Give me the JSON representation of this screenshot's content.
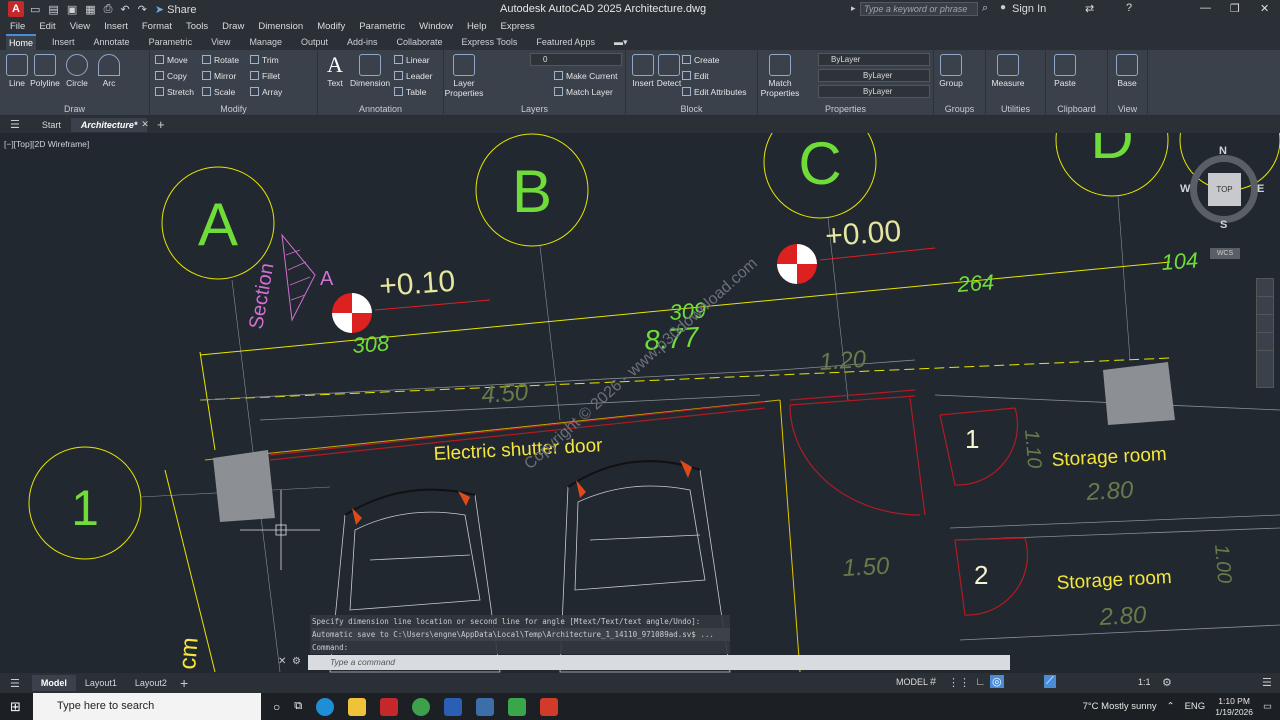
{
  "title_bar": {
    "app_icon": "A",
    "share_label": "Share",
    "title": "Autodesk AutoCAD 2025   Architecture.dwg",
    "search_placeholder": "Type a keyword or phrase",
    "sign_in": "Sign In"
  },
  "menu": [
    "File",
    "Edit",
    "View",
    "Insert",
    "Format",
    "Tools",
    "Draw",
    "Dimension",
    "Modify",
    "Parametric",
    "Window",
    "Help",
    "Express"
  ],
  "ribbon_tabs": [
    "Home",
    "Insert",
    "Annotate",
    "Parametric",
    "View",
    "Manage",
    "Output",
    "Add-ins",
    "Collaborate",
    "Express Tools",
    "Featured Apps"
  ],
  "ribbon": {
    "draw": {
      "title": "Draw",
      "tools": [
        "Line",
        "Polyline",
        "Circle",
        "Arc"
      ]
    },
    "modify": {
      "title": "Modify",
      "tools": [
        "Move",
        "Rotate",
        "Trim",
        "Copy",
        "Mirror",
        "Fillet",
        "Stretch",
        "Scale",
        "Array"
      ]
    },
    "annotation": {
      "title": "Annotation",
      "tools": [
        "Text",
        "Dimension",
        "Linear",
        "Leader",
        "Table"
      ]
    },
    "layers": {
      "title": "Layers",
      "layer_properties": "Layer Properties",
      "current_layer": "0",
      "make_current": "Make Current",
      "match_layer": "Match Layer"
    },
    "block": {
      "title": "Block",
      "tools": [
        "Insert",
        "Detect",
        "Create",
        "Edit",
        "Edit Attributes"
      ]
    },
    "properties": {
      "title": "Properties",
      "match": "Match Properties",
      "color": "ByLayer",
      "linetype": "ByLayer",
      "lineweight": "ByLayer"
    },
    "groups": {
      "title": "Groups",
      "group": "Group"
    },
    "utilities": {
      "title": "Utilities",
      "measure": "Measure"
    },
    "clipboard": {
      "title": "Clipboard",
      "paste": "Paste"
    },
    "view": {
      "title": "View",
      "base": "Base"
    }
  },
  "doc_tabs": [
    "Start",
    "Architecture*"
  ],
  "viewport": {
    "label": "[−][Top][2D Wireframe]",
    "viewcube": {
      "top": "TOP",
      "n": "N",
      "s": "S",
      "e": "E",
      "w": "W",
      "wcs": "WCS"
    },
    "grid_bubbles": [
      "A",
      "B",
      "C",
      "D",
      "1"
    ],
    "levels": [
      "+0.10",
      "+0.00"
    ],
    "dims": [
      "308",
      "309",
      "264",
      "104",
      "8.77",
      "4.50",
      "1.20",
      "2.80",
      "1.50",
      "2.80",
      "1.00",
      "1.10"
    ],
    "section_label": "Section",
    "section_tag": "A",
    "room_labels": [
      "Electric shutter door",
      "Storage room",
      "Storage room"
    ],
    "door_tags": [
      "1",
      "2"
    ],
    "watermark": "Copyright © 2026 - www.p30download.com",
    "cm_label": "cm"
  },
  "command": {
    "history": [
      "Specify dimension line location or second line for angle [Mtext/Text/text angle/Undo]:",
      "Automatic save to C:\\Users\\engne\\AppData\\Local\\Temp\\Architecture_1_14110_971089ad.sv$ ...",
      "Command:"
    ],
    "placeholder": "Type a command"
  },
  "layout_tabs": [
    "Model",
    "Layout1",
    "Layout2"
  ],
  "status": {
    "model": "MODEL",
    "scale": "1:1"
  },
  "taskbar": {
    "search": "Type here to search",
    "weather": "7°C  Mostly sunny",
    "lang": "ENG",
    "time": "1:10 PM",
    "date": "1/19/2026"
  }
}
